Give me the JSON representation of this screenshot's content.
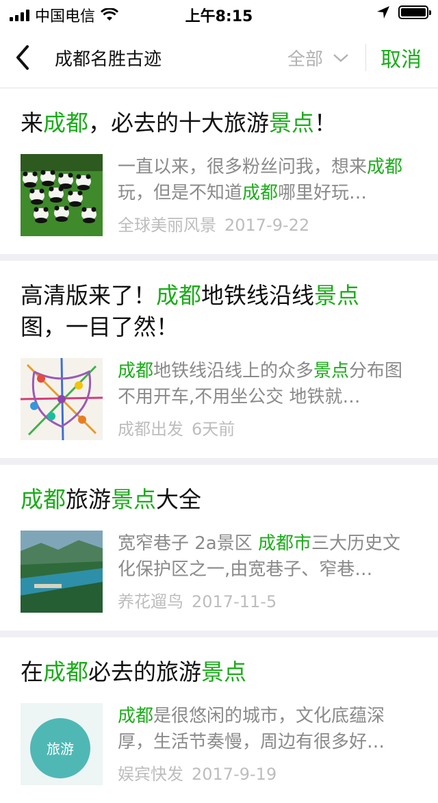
{
  "status_bar": {
    "carrier": "中国电信",
    "time": "上午8:15"
  },
  "nav": {
    "query": "成都名胜古迹",
    "filter_label": "全部",
    "cancel_label": "取消"
  },
  "colors": {
    "accent": "#1aad19",
    "meta": "#bdbdbd",
    "desc": "#8a8a8a"
  },
  "results": [
    {
      "title": [
        {
          "t": "来"
        },
        {
          "t": "成都",
          "hl": true
        },
        {
          "t": "，必去的十大旅游"
        },
        {
          "t": "景点",
          "hl": true
        },
        {
          "t": "！"
        }
      ],
      "desc": [
        {
          "t": "一直以来，很多粉丝问我，想来"
        },
        {
          "t": "成都",
          "hl": true
        },
        {
          "t": "玩，但是不知道"
        },
        {
          "t": "成都",
          "hl": true
        },
        {
          "t": "哪里好玩…"
        }
      ],
      "source": "全球美丽风景",
      "date": "2017-9-22",
      "thumb": "panda-photo"
    },
    {
      "title": [
        {
          "t": "高清版来了！"
        },
        {
          "t": "成都",
          "hl": true
        },
        {
          "t": "地铁线沿线"
        },
        {
          "t": "景点",
          "hl": true
        },
        {
          "t": "图，一目了然！"
        }
      ],
      "desc": [
        {
          "t": "成都",
          "hl": true
        },
        {
          "t": "地铁线沿线上的众多"
        },
        {
          "t": "景点",
          "hl": true
        },
        {
          "t": "分布图 不用开车,不用坐公交 地铁就…"
        }
      ],
      "source": "成都出发",
      "date": "6天前",
      "thumb": "metro-map"
    },
    {
      "title": [
        {
          "t": "成都",
          "hl": true
        },
        {
          "t": "旅游"
        },
        {
          "t": "景点",
          "hl": true
        },
        {
          "t": "大全"
        }
      ],
      "desc": [
        {
          "t": "宽窄巷子 2a景区 "
        },
        {
          "t": "成都市",
          "hl": true
        },
        {
          "t": "三大历史文化保护区之一,由宽巷子、窄巷…"
        }
      ],
      "source": "养花遛鸟",
      "date": "2017-11-5",
      "thumb": "landscape-photo"
    },
    {
      "title": [
        {
          "t": "在"
        },
        {
          "t": "成都",
          "hl": true
        },
        {
          "t": "必去的旅游"
        },
        {
          "t": "景点",
          "hl": true
        }
      ],
      "desc": [
        {
          "t": "成都",
          "hl": true
        },
        {
          "t": "是很悠闲的城市，文化底蕴深厚，生活节奏慢，周边有很多好…"
        }
      ],
      "source": "娱宾快发",
      "date": "2017-9-19",
      "thumb": "travel-badge",
      "thumb_text": "旅游"
    }
  ]
}
